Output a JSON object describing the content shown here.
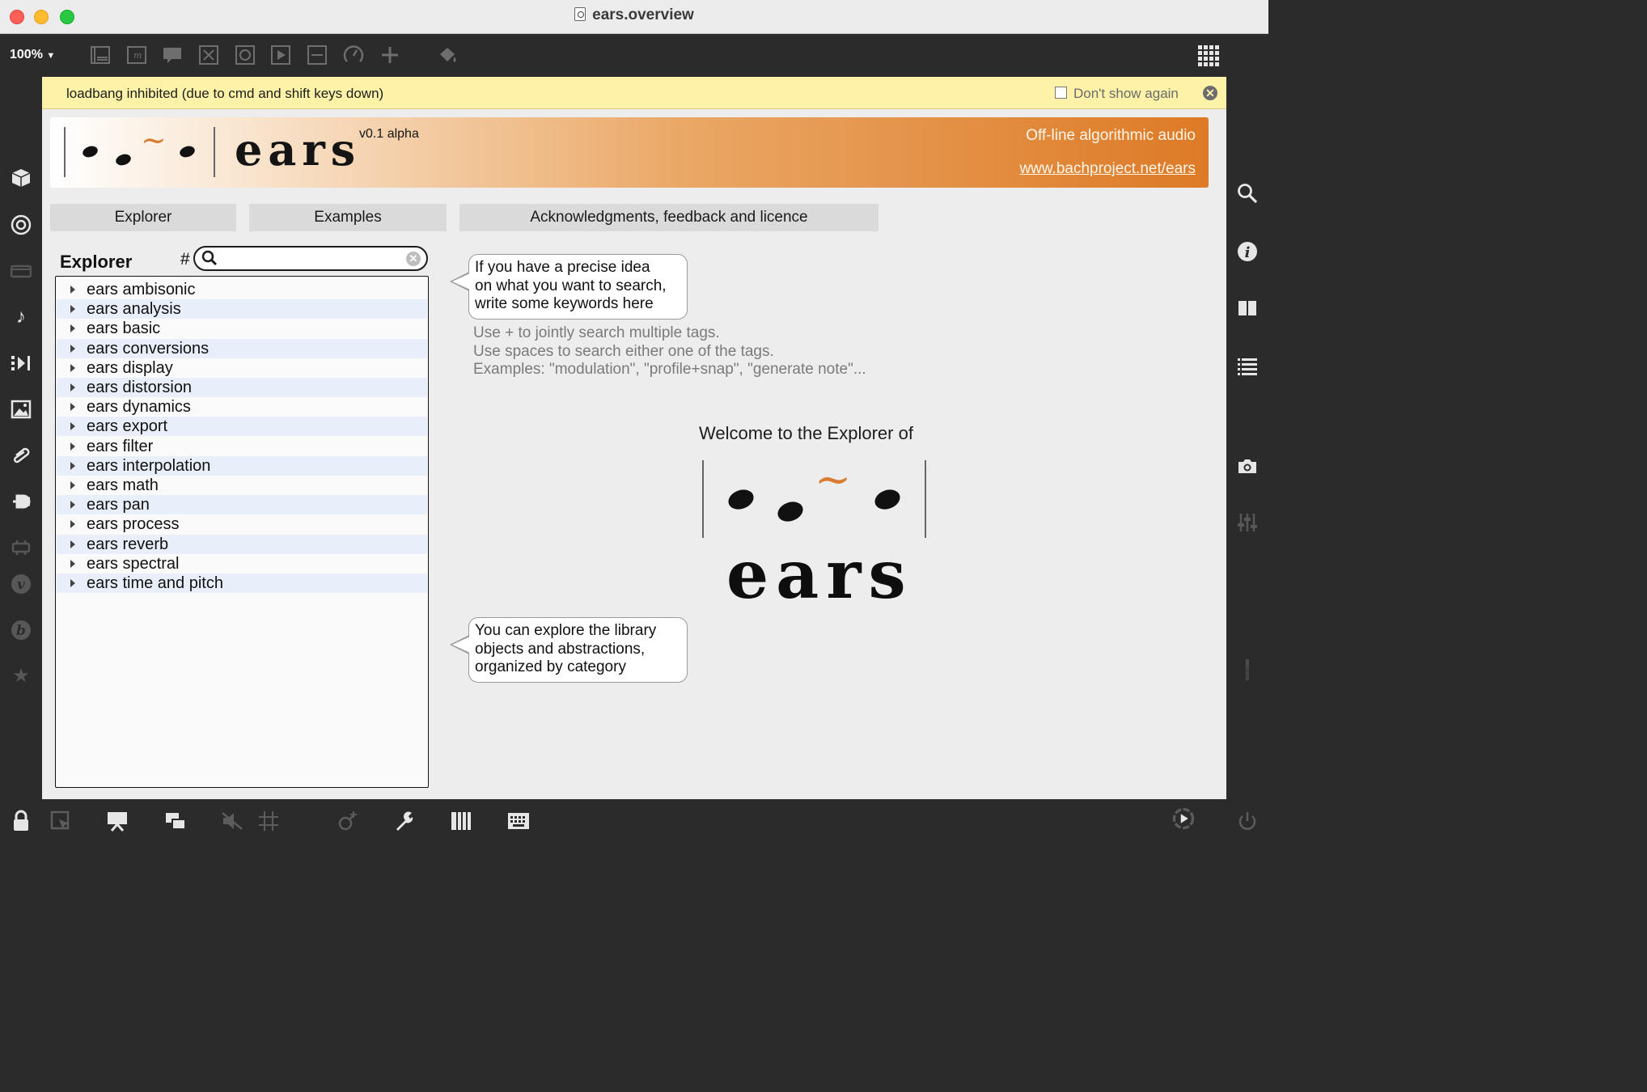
{
  "window": {
    "title": "ears.overview"
  },
  "toolbar": {
    "zoom": "100%",
    "icons": [
      "new-object-icon",
      "message-icon",
      "comment-icon",
      "button-icon",
      "toggle-icon",
      "play-icon",
      "slider-icon",
      "dial-icon",
      "add-icon",
      "paint-bucket-icon",
      "grid-icon"
    ]
  },
  "infobar": {
    "message": "loadbang inhibited (due to cmd and shift keys down)",
    "dont_show_again": "Don't show again"
  },
  "banner": {
    "logo_text": "ears",
    "version": "v0.1 alpha",
    "tagline": "Off-line algorithmic audio",
    "url": "www.bachproject.net/ears"
  },
  "tabs": [
    "Explorer",
    "Examples",
    "Acknowledgments, feedback and licence"
  ],
  "explorer": {
    "title": "Explorer",
    "hash": "#",
    "search_value": "",
    "categories": [
      "ears ambisonic",
      "ears analysis",
      "ears basic",
      "ears conversions",
      "ears display",
      "ears distorsion",
      "ears dynamics",
      "ears export",
      "ears filter",
      "ears interpolation",
      "ears math",
      "ears pan",
      "ears process",
      "ears reverb",
      "ears spectral",
      "ears time and pitch"
    ]
  },
  "search_tip": {
    "lines": [
      "If you have a precise idea",
      "on what you want to search,",
      "write some keywords here"
    ]
  },
  "search_hints": [
    "Use + to jointly search multiple tags.",
    "Use spaces to search either one of the tags.",
    "Examples: \"modulation\", \"profile+snap\", \"generate note\"..."
  ],
  "welcome": {
    "heading": "Welcome to the Explorer of",
    "logo_text": "ears"
  },
  "explore_tip": {
    "lines": [
      "You can explore the library",
      "objects and abstractions,",
      "organized by category"
    ]
  },
  "colors": {
    "accent_orange": "#dd7a26",
    "tilde": "#d97c30",
    "infobar_bg": "#fdf2a8",
    "list_alt_row": "#e8effb"
  }
}
